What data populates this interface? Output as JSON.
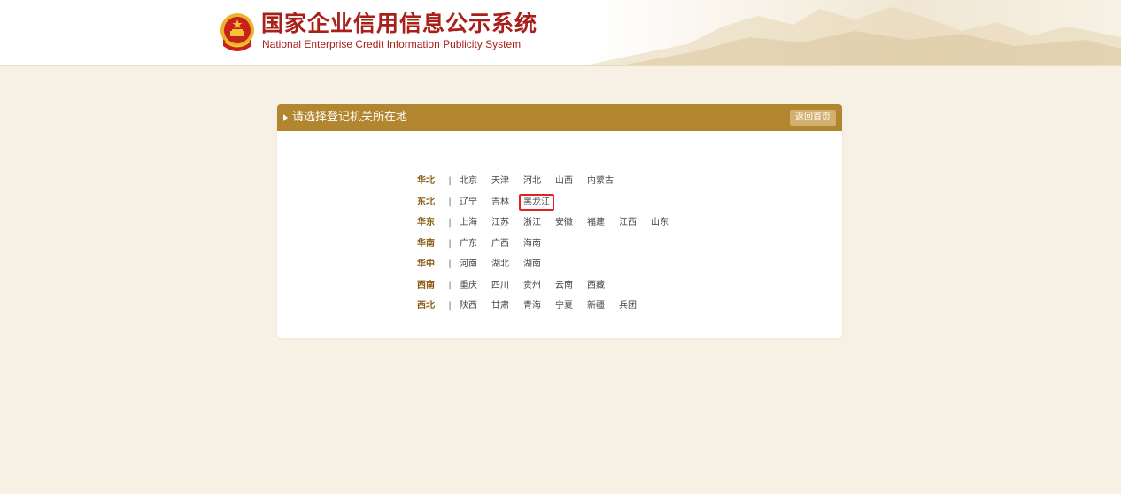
{
  "header": {
    "title_cn": "国家企业信用信息公示系统",
    "title_en": "National Enterprise Credit Information Publicity System",
    "emblem_icon": "national-emblem-icon"
  },
  "panel": {
    "title": "请选择登记机关所在地",
    "home_button": "返回首页"
  },
  "regions": [
    {
      "name": "华北",
      "provinces": [
        "北京",
        "天津",
        "河北",
        "山西",
        "内蒙古"
      ]
    },
    {
      "name": "东北",
      "provinces": [
        "辽宁",
        "吉林",
        "黑龙江"
      ]
    },
    {
      "name": "华东",
      "provinces": [
        "上海",
        "江苏",
        "浙江",
        "安徽",
        "福建",
        "江西",
        "山东"
      ]
    },
    {
      "name": "华南",
      "provinces": [
        "广东",
        "广西",
        "海南"
      ]
    },
    {
      "name": "华中",
      "provinces": [
        "河南",
        "湖北",
        "湖南"
      ]
    },
    {
      "name": "西南",
      "provinces": [
        "重庆",
        "四川",
        "贵州",
        "云南",
        "西藏"
      ]
    },
    {
      "name": "西北",
      "provinces": [
        "陕西",
        "甘肃",
        "青海",
        "宁夏",
        "新疆",
        "兵团"
      ]
    }
  ],
  "separator": "|",
  "selected_province": "黑龙江",
  "colors": {
    "brand_red": "#a8201a",
    "panel_header": "#b2862e",
    "region_label": "#8b5a14",
    "highlight": "#e02424",
    "page_bg": "#f7f1e5"
  }
}
